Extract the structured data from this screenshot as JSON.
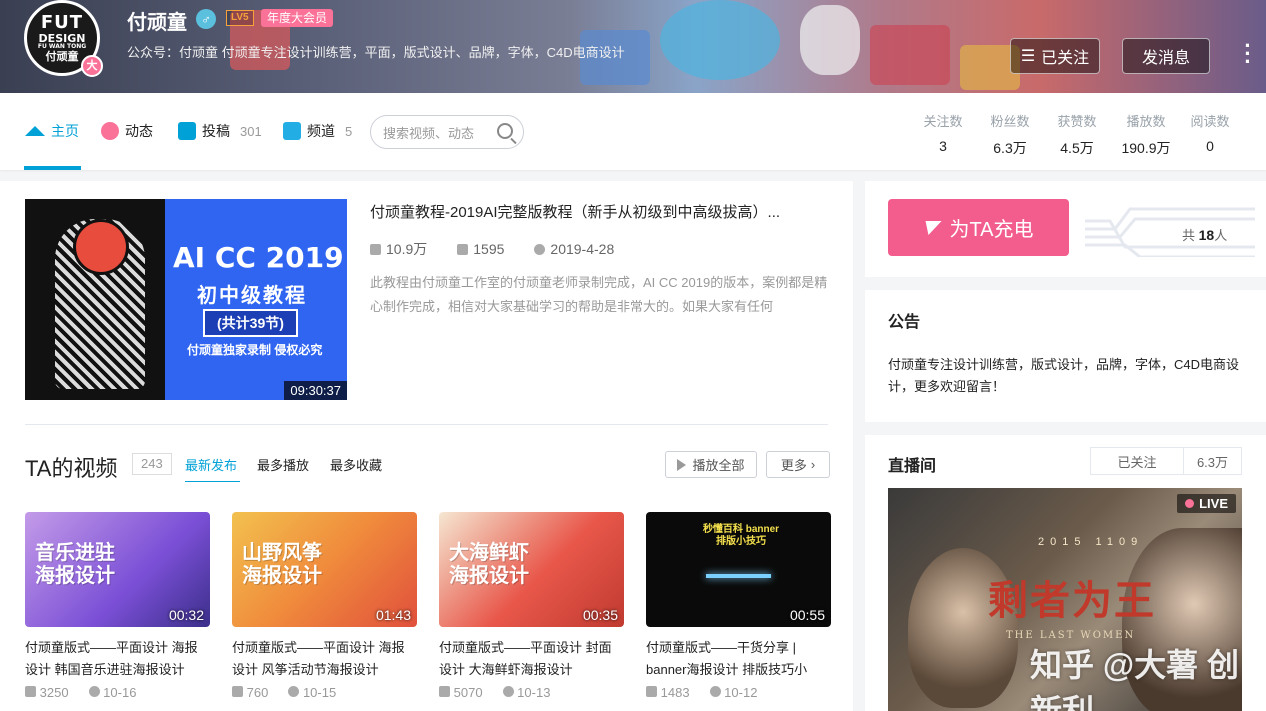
{
  "header": {
    "avatar_text_top": "FUT",
    "avatar_text_mid": "DESIGN",
    "avatar_text_small": "FU WAN TONG",
    "avatar_text_bottom": "付顽童",
    "avatar_badge": "大",
    "name": "付顽童",
    "gender_icon": "♂",
    "level": "LV5",
    "vip_label": "年度大会员",
    "sign": "公众号：付顽童 付顽童专注设计训练营，平面，版式设计、品牌，字体，C4D电商设计",
    "followed_label": "已关注",
    "message_label": "发消息",
    "more_label": "⋮"
  },
  "nav": {
    "items": [
      {
        "label": "主页",
        "count": "",
        "icon": "home-icon",
        "color": "#00a1d6"
      },
      {
        "label": "动态",
        "count": "",
        "icon": "dynamic-icon",
        "color": "#fb7299"
      },
      {
        "label": "投稿",
        "count": "301",
        "icon": "upload-icon",
        "color": "#00a1d6"
      },
      {
        "label": "频道",
        "count": "5",
        "icon": "channel-icon",
        "color": "#00a1d6"
      }
    ],
    "search_placeholder": "搜索视频、动态",
    "stats": [
      {
        "label": "关注数",
        "value": "3"
      },
      {
        "label": "粉丝数",
        "value": "6.3万"
      },
      {
        "label": "获赞数",
        "value": "4.5万"
      },
      {
        "label": "播放数",
        "value": "190.9万"
      },
      {
        "label": "阅读数",
        "value": "0"
      }
    ]
  },
  "featured": {
    "thumb_title": "AI CC 2019",
    "thumb_sub": "初中级教程",
    "thumb_box": "(共计39节)",
    "thumb_note": "付顽童独家录制 侵权必究",
    "duration": "09:30:37",
    "title": "付顽童教程-2019AI完整版教程（新手从初级到中高级拔高）...",
    "plays": "10.9万",
    "danmaku": "1595",
    "date": "2019-4-28",
    "desc": "此教程由付顽童工作室的付顽童老师录制完成，AI CC 2019的版本，案例都是精心制作完成，相信对大家基础学习的帮助是非常大的。如果大家有任何"
  },
  "videos_section": {
    "title": "TA的视频",
    "count": "243",
    "tabs": [
      "最新发布",
      "最多播放",
      "最多收藏"
    ],
    "play_all": "播放全部",
    "more": "更多"
  },
  "videos": [
    {
      "thumb_text": "音乐进驻 海报设计",
      "duration": "00:32",
      "title": "付顽童版式——平面设计 海报设计 韩国音乐进驻海报设计",
      "plays": "3250",
      "date": "10-16",
      "bg": "#7b4fd6"
    },
    {
      "thumb_text": "山野风筝 海报设计",
      "duration": "01:43",
      "title": "付顽童版式——平面设计 海报设计 风筝活动节海报设计",
      "plays": "760",
      "date": "10-15",
      "bg": "#f08a3c"
    },
    {
      "thumb_text": "大海鲜虾 海报设计",
      "duration": "00:35",
      "title": "付顽童版式——平面设计 封面设计 大海鲜虾海报设计",
      "plays": "5070",
      "date": "10-13",
      "bg": "#e8574a"
    },
    {
      "thumb_text": "秒懂百科 banner 排版小技巧",
      "duration": "00:55",
      "title": "付顽童版式——干货分享 | banner海报设计 排版技巧小",
      "plays": "1483",
      "date": "10-12",
      "bg": "#0a0a0a"
    }
  ],
  "charge": {
    "label": "为TA充电",
    "count_prefix": "共",
    "count": "18",
    "count_suffix": "人"
  },
  "notice": {
    "title": "公告",
    "text": "付顽童专注设计训练营，版式设计，品牌，字体，C4D电商设计，更多欢迎留言！"
  },
  "live": {
    "title": "直播间",
    "followed": "已关注",
    "fans": "6.3万",
    "badge": "LIVE",
    "cover_title": "剩者为王",
    "cover_year": "2015 1109",
    "cover_en": "THE LAST WOMEN"
  },
  "watermark": "知乎 @大薯 创新利",
  "colors": {
    "accent": "#00a1d6",
    "pink": "#fb7299",
    "charge": "#f25d8e"
  }
}
